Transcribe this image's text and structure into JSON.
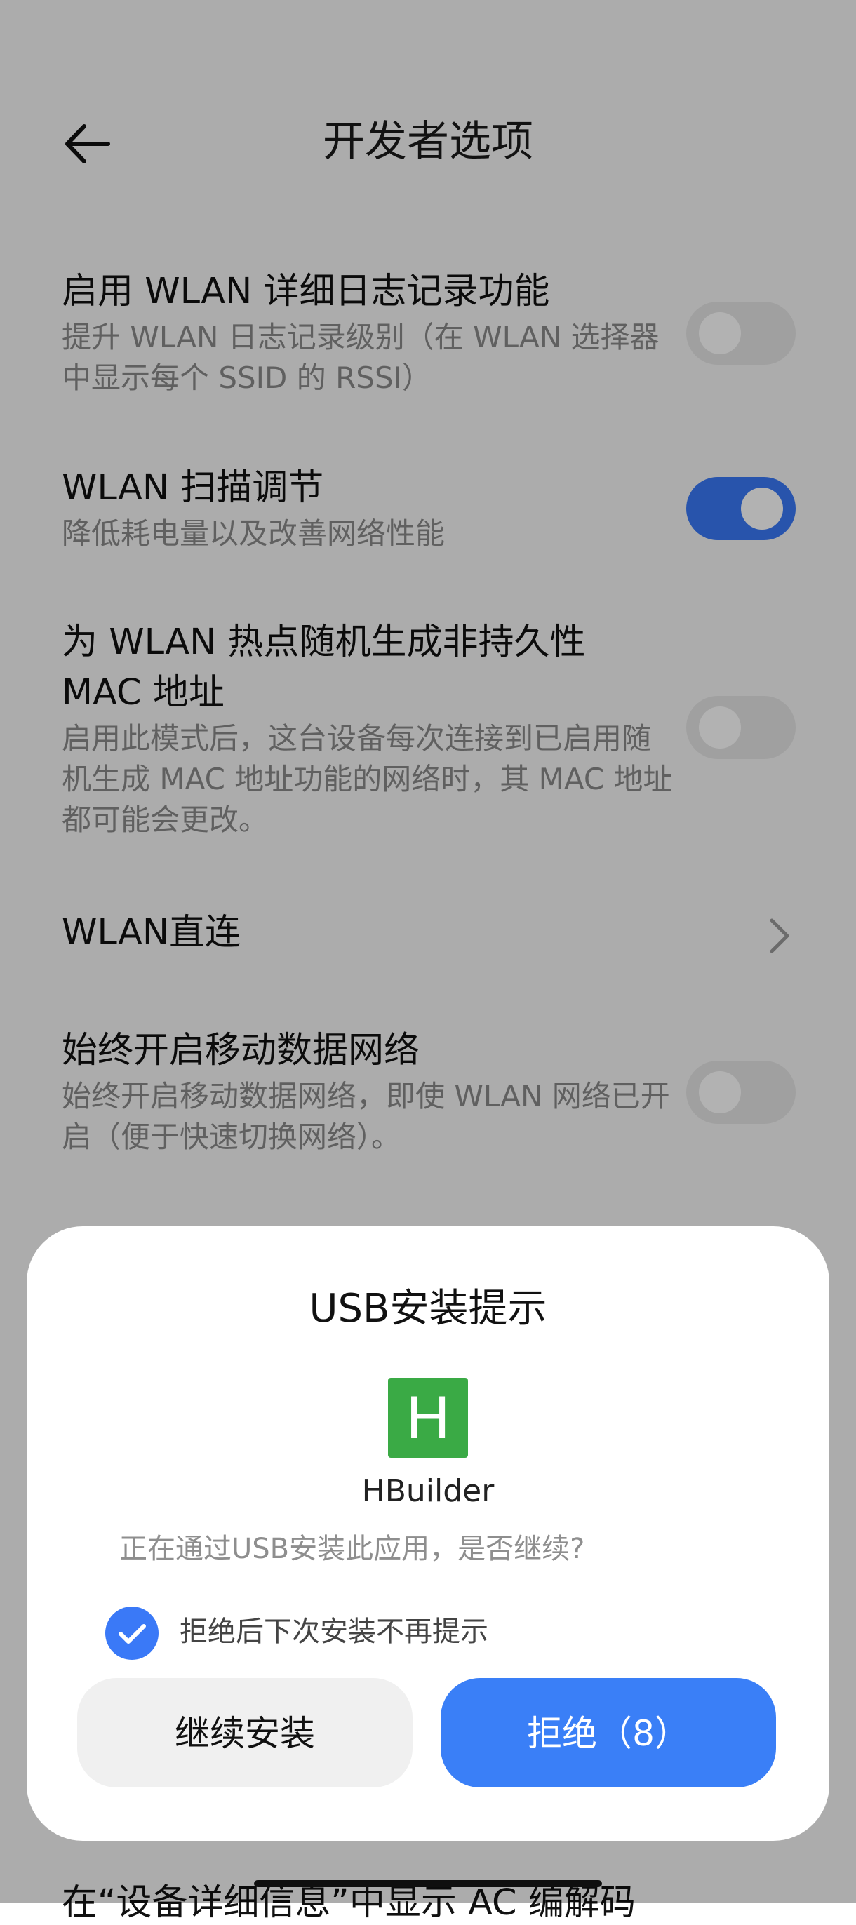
{
  "header": {
    "title": "开发者选项",
    "back_icon": "back-arrow-icon"
  },
  "settings": [
    {
      "title": "启用 WLAN 详细日志记录功能",
      "subtitle": "提升 WLAN 日志记录级别（在 WLAN 选择器中显示每个 SSID 的 RSSI）",
      "toggle": false
    },
    {
      "title": "WLAN 扫描调节",
      "subtitle": "降低耗电量以及改善网络性能",
      "toggle": true
    },
    {
      "title": "为 WLAN 热点随机生成非持久性 MAC 地址",
      "subtitle": "启用此模式后，这台设备每次连接到已启用随机生成 MAC 地址功能的网络时，其 MAC 地址都可能会更改。",
      "toggle": false
    },
    {
      "title": "WLAN直连",
      "chevron_icon": "chevron-right-icon"
    },
    {
      "title": "始终开启移动数据网络",
      "subtitle": "始终开启移动数据网络，即使 WLAN 网络已开启（便于快速切换网络）。",
      "toggle": false
    }
  ],
  "bottom_peek_text": "在“设备详细信息”中显示 AC 编解码",
  "dialog": {
    "title": "USB安装提示",
    "app_icon_letter": "H",
    "app_name": "HBuilder",
    "prompt": "正在通过USB安装此应用，是否继续?",
    "checkbox_label": "拒绝后下次安装不再提示",
    "checkbox_checked": true,
    "continue_label": "继续安装",
    "reject_label": "拒绝（8）"
  },
  "colors": {
    "accent": "#3a79f7",
    "toggle_off": "#e6e6e6",
    "app_icon": "#3aaa45"
  }
}
